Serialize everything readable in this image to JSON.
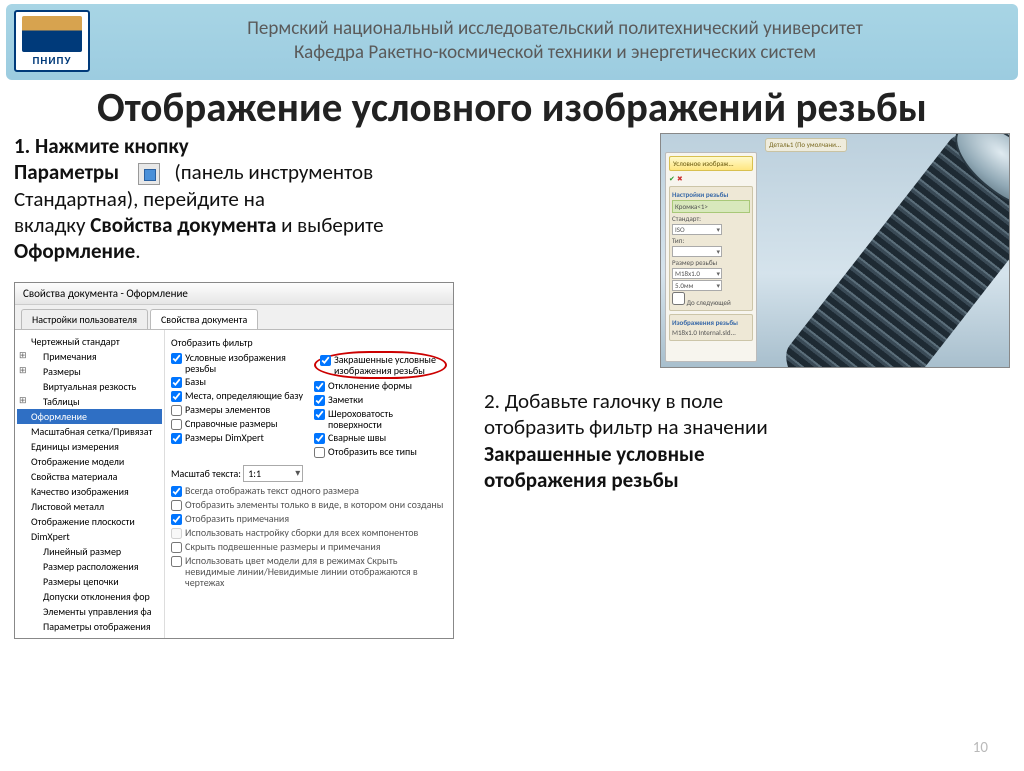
{
  "header": {
    "uni": "Пермский национальный исследовательский политехнический университет",
    "dept": "Кафедра Ракетно-космической техники и энергетических систем",
    "logo_abbr": "ПНИПУ"
  },
  "title": "Отображение условного изображений резьбы",
  "step1": {
    "lead": "1. Нажмите кнопку",
    "l1a": "Параметры",
    "l1b": " (панель инструментов",
    "l2": "Стандартная), перейдите на",
    "l3a": "вкладку ",
    "l3b": "Свойства документа",
    "l3c": " и выберите",
    "l4": "Оформление",
    "dot": "."
  },
  "step2": {
    "l1": "2. Добавьте галочку в поле",
    "l2": "отобразить фильтр на значении",
    "l3": "Закрашенные условные",
    "l4": "отображения резьбы"
  },
  "dialog": {
    "title": "Свойства документа - Оформление",
    "tab_user": "Настройки пользователя",
    "tab_doc": "Свойства документа",
    "tree": {
      "std": "Чертежный стандарт",
      "notes": "Примечания",
      "dims": "Размеры",
      "virt": "Виртуальная резкость",
      "tables": "Таблицы",
      "design": "Оформление",
      "grid": "Масштабная сетка/Привязат",
      "units": "Единицы измерения",
      "model_disp": "Отображение модели",
      "mat_prop": "Свойства материала",
      "img_qual": "Качество изображения",
      "sheet": "Листовой металл",
      "plane_disp": "Отображение плоскости",
      "dimxpert": "DimXpert",
      "lin": "Линейный размер",
      "pos": "Размер расположения",
      "chain": "Размеры цепочки",
      "tol": "Допуски отклонения фор",
      "ctrl": "Элементы управления фа",
      "disp_par": "Параметры отображения"
    },
    "pane": {
      "filter_label": "Отобразить фильтр",
      "c1": "Условные изображения резьбы",
      "c2": "Базы",
      "c3": "Места, определяющие базу",
      "c4": "Размеры элементов",
      "c5": "Справочные размеры",
      "c6": "Размеры DimXpert",
      "r1a": "Закрашенные условные",
      "r1b": "изображения резьбы",
      "r2": "Отклонение формы",
      "r3": "Заметки",
      "r4": "Шероховатость поверхности",
      "r5": "Сварные швы",
      "r6": "Отобразить все типы",
      "scale_label": "Масштаб текста:",
      "scale_value": "1:1",
      "b1": "Всегда отображать текст одного размера",
      "b2": "Отобразить элементы только в виде, в котором они созданы",
      "b3": "Отобразить примечания",
      "b4": "Использовать настройку сборки для всех компонентов",
      "b5": "Скрыть подвешенные размеры и примечания",
      "b6": "Использовать цвет модели для в режимах Скрыть невидимые линии/Невидимые линии отображаются в чертежах"
    }
  },
  "thumb": {
    "tab": "Деталь1 (По умолчани...",
    "panel_title": "Условное изображ...",
    "section1": "Настройки резьбы",
    "item": "Кромка<1>",
    "lbl_std": "Стандарт:",
    "std_val": "ISO",
    "lbl_type": "Тип:",
    "lbl_size": "Размер резьбы",
    "size_val": "M18x1.0",
    "len_val": "5.0мм",
    "opt1": "До следующей",
    "section2": "Изображения резьбы",
    "file": "M18x1.0 Internal.sld..."
  },
  "page": "10"
}
